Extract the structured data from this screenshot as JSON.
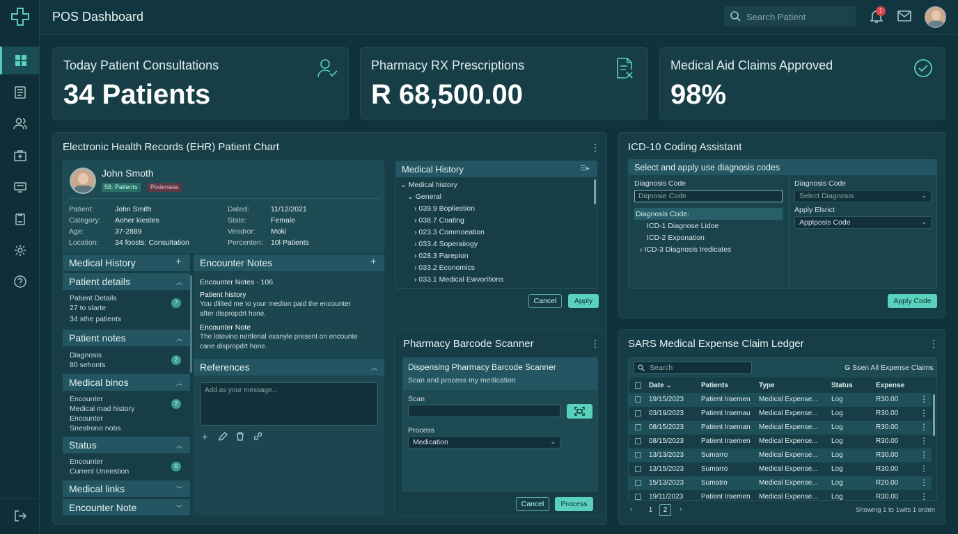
{
  "app": {
    "title": "POS Dashboard",
    "search_placeholder": "Search Patient",
    "notif_count": "1"
  },
  "kpis": [
    {
      "title": "Today Patient Consultations",
      "value": "34 Patients"
    },
    {
      "title": "Pharmacy RX Prescriptions",
      "value": "R 68,500.00"
    },
    {
      "title": "Medical Aid Claims Approved",
      "value": "98%"
    }
  ],
  "ehr": {
    "title": "Electronic Health Records (EHR) Patient Chart",
    "patient": {
      "name": "John Smoth",
      "tag1": "58. Patients",
      "tag2": "Podenase"
    },
    "fields": [
      {
        "l": "Patient:",
        "v": "John Smith"
      },
      {
        "l": "Category:",
        "v": "Aoher kiestes"
      },
      {
        "l": "Age:",
        "v": "37-2889"
      },
      {
        "l": "Location:",
        "v": "34 foosts: Consultation"
      }
    ],
    "fields2": [
      {
        "l": "Dated:",
        "v": "11/12/2021"
      },
      {
        "l": "State:",
        "v": "Female"
      },
      {
        "l": "Vendror:",
        "v": "Moki"
      },
      {
        "l": "Percenten:",
        "v": "10l Patients"
      }
    ],
    "left_sections": {
      "s0": "Medical History",
      "s1": "Patient details",
      "s1_lines": [
        "Patient Details",
        "27 to slarte",
        "34 sthe patients"
      ],
      "s1_badge": "7",
      "s2": "Patient notes",
      "s2_lines": [
        "Diagnosis",
        "80 sehonts"
      ],
      "s2_badge": "2",
      "s3": "Medical binos",
      "s3_lines": [
        "Encounter",
        "Medical mad history",
        "Encounter",
        "Snestrono nobs"
      ],
      "s3_badge": "2",
      "s4": "Status",
      "s4_lines": [
        "Encounter",
        "Current Uneestion"
      ],
      "s4_badge": "0",
      "s5": "Medical links",
      "s6": "Encounter Note"
    },
    "encounter": {
      "title": "Encounter Notes",
      "sub": "Encounter Notes · 106",
      "h1": "Patient history",
      "t1a": "You dlilted me to your medion paid the encounter",
      "t1b": "after dispropdrt hone.",
      "h2": "Encounter Note",
      "t2a": "The lotevino nertlenal exanyle present on encounte",
      "t2b": "cane dispropdrt hone."
    },
    "refs": {
      "title": "References",
      "placeholder": "Add as your message..."
    },
    "history": {
      "title": "Medical History",
      "root": "Medical history",
      "group": "General",
      "items": [
        "039.9 Bopliestion",
        "038.7 Coating",
        "023.3 Commoeation",
        "033.4 Soperaiiogy",
        "028.3 Parepion",
        "033.2 Economics",
        "033.1 Medical Ewvoritions"
      ],
      "cancel": "Cancel",
      "apply": "Apply"
    }
  },
  "icd": {
    "title": "ICD-10 Coding Assistant",
    "subtitle": "Select and apply use diagnosis codes",
    "dx_label": "Diagnosis Code",
    "dx_placeholder": "Diqnosie Code",
    "tree_title": "Diagnosis Code:",
    "tree": [
      "ICD-1 Diagnose Lidoe",
      "ICD-2 Exponation",
      "ICD-3 Diagnosis Iredicates"
    ],
    "dx_label2": "Diagnosis Code",
    "dx_select": "Select Diagnosis",
    "apply_label": "Apply Elsrict",
    "apply_select": "Applposis Code",
    "apply_btn": "Apply Code"
  },
  "scanner": {
    "title": "Pharmacy Barcode Scanner",
    "sub_title": "Dispensing Pharmacy Barcode Scanner",
    "sub_desc": "Scan and process my medication",
    "scan_label": "Scan",
    "process_label": "Process",
    "process_select": "Medication",
    "cancel": "Cancel",
    "process": "Process"
  },
  "ledger": {
    "title": "SARS Medical Expense Claim Ledger",
    "search_placeholder": "Search",
    "filter": "Ǥ Ssen All Expense Claims",
    "headers": [
      "Date",
      "Patients",
      "Type",
      "Status",
      "Expense"
    ],
    "rows": [
      [
        "19/15/2023",
        "Patient Iraemen",
        "Medical Expense...",
        "Log",
        "R30.00"
      ],
      [
        "03/19/2023",
        "Patient Iraemau",
        "Medical Expense...",
        "Log",
        "R30.00"
      ],
      [
        "08/15/2023",
        "Patient Iraeman",
        "Medical Expense...",
        "Log",
        "R30.00"
      ],
      [
        "08/15/2023",
        "Patient Iraemen",
        "Medical Expense...",
        "Log",
        "R30.00"
      ],
      [
        "13/13/2023",
        "Sumarro",
        "Medical Expense...",
        "Log",
        "R30.00"
      ],
      [
        "13/15/2023",
        "Sumarro",
        "Medical Expense...",
        "Log",
        "R30.00"
      ],
      [
        "15/13/2023",
        "Sumatro",
        "Medical Expense...",
        "Log",
        "R20.00"
      ],
      [
        "19/11/2023",
        "Patient Iraemen",
        "Medical Expense...",
        "Log",
        "R30.00"
      ]
    ],
    "pages": [
      "1",
      "2"
    ],
    "footer": "Showing 1 to 1wits 1 orden"
  },
  "colors": {
    "accent": "#5ad1bb",
    "bg": "#10323a",
    "panel": "#173e47"
  }
}
